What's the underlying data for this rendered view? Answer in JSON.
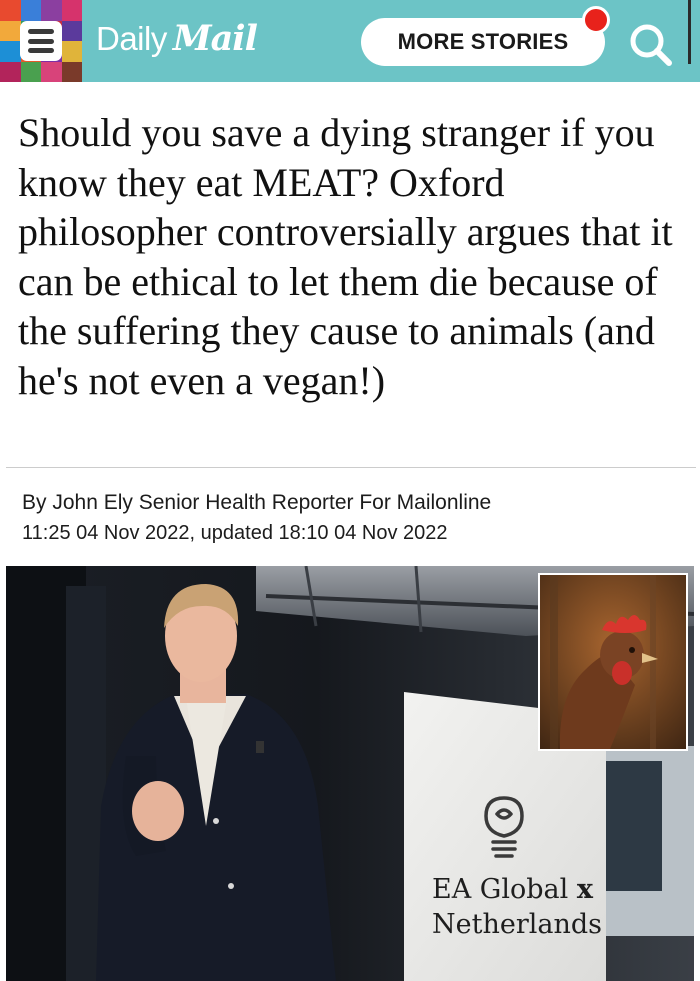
{
  "header": {
    "logo_daily": "Daily",
    "logo_mail": "Mail",
    "more_stories_label": "MORE STORIES",
    "menu_icon": "hamburger-menu-icon",
    "search_icon": "search-icon",
    "brand_color": "#6cc4c6",
    "notification_color": "#e8221b"
  },
  "article": {
    "headline": "Should you save a dying stranger if you know they eat MEAT? Oxford philosopher controversially argues that it can be ethical to let them die because of the suffering they cause to animals (and he's not even a vegan!)",
    "byline": "By John Ely Senior Health Reporter For Mailonline",
    "dateline": "11:25 04 Nov 2022, updated 18:10 04 Nov 2022"
  },
  "photo": {
    "banner_line1": "EA Global",
    "banner_x": "x",
    "banner_line2": "Netherlands"
  }
}
